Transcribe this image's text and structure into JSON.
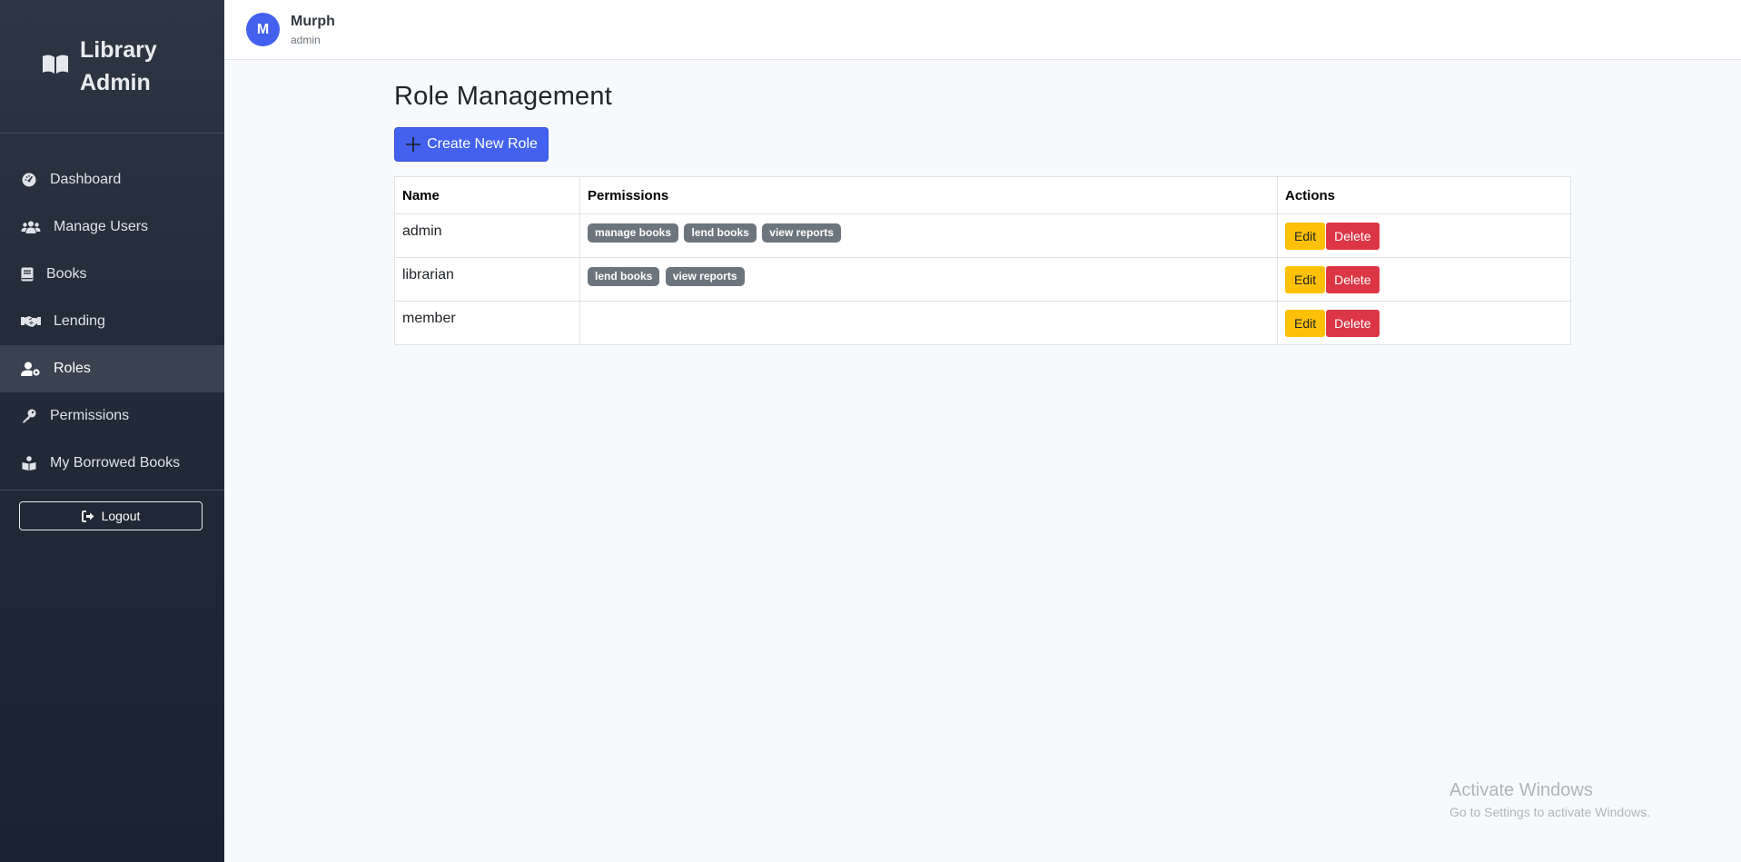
{
  "brand": {
    "line1": "Library",
    "line2": "Admin",
    "icon": "book-open-icon"
  },
  "sidebar": {
    "items": [
      {
        "label": "Dashboard",
        "icon": "gauge-icon",
        "active": false
      },
      {
        "label": "Manage Users",
        "icon": "users-icon",
        "active": false
      },
      {
        "label": "Books",
        "icon": "book-icon",
        "active": false
      },
      {
        "label": "Lending",
        "icon": "handshake-icon",
        "active": false
      },
      {
        "label": "Roles",
        "icon": "user-gear-icon",
        "active": true
      },
      {
        "label": "Permissions",
        "icon": "key-icon",
        "active": false
      },
      {
        "label": "My Borrowed Books",
        "icon": "book-reader-icon",
        "active": false
      }
    ],
    "logout_label": "Logout"
  },
  "user": {
    "initial": "M",
    "name": "Murph",
    "role": "admin"
  },
  "main": {
    "title": "Role Management",
    "create_button": "Create New Role",
    "table": {
      "headers": [
        "Name",
        "Permissions",
        "Actions"
      ],
      "rows": [
        {
          "name": "admin",
          "permissions": [
            "manage books",
            "lend books",
            "view reports"
          ]
        },
        {
          "name": "librarian",
          "permissions": [
            "lend books",
            "view reports"
          ]
        },
        {
          "name": "member",
          "permissions": []
        }
      ],
      "edit_label": "Edit",
      "delete_label": "Delete"
    }
  },
  "colors": {
    "sidebar_bg": "#2e3644",
    "accent": "#4361ee",
    "badge": "#6c757d",
    "edit": "#ffc107",
    "delete": "#dc3545"
  },
  "watermark": {
    "title": "Activate Windows",
    "subtitle": "Go to Settings to activate Windows."
  }
}
